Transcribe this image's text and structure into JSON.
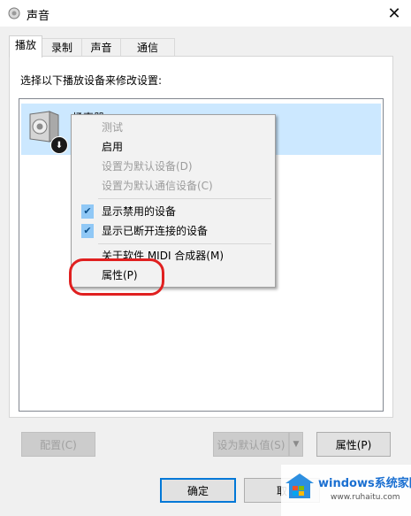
{
  "window": {
    "title": "声音",
    "close_glyph": "✕"
  },
  "tabs": [
    {
      "label": "播放",
      "active": true
    },
    {
      "label": "录制",
      "active": false
    },
    {
      "label": "声音",
      "active": false
    },
    {
      "label": "通信",
      "active": false
    }
  ],
  "panel": {
    "instruction": "选择以下播放设备来修改设置:",
    "device": {
      "name": "扬声器",
      "state": "disabled",
      "icon": "speaker-icon"
    }
  },
  "buttons": {
    "configure": "配置(C)",
    "set_default": "设为默认值(S)",
    "properties": "属性(P)",
    "ok": "确定",
    "cancel": "取"
  },
  "context_menu": {
    "items": [
      {
        "label": "测试",
        "enabled": false,
        "checked": false
      },
      {
        "label": "启用",
        "enabled": true,
        "checked": false
      },
      {
        "label": "设置为默认设备(D)",
        "enabled": false,
        "checked": false
      },
      {
        "label": "设置为默认通信设备(C)",
        "enabled": false,
        "checked": false
      },
      {
        "label": "显示禁用的设备",
        "enabled": true,
        "checked": true
      },
      {
        "label": "显示已断开连接的设备",
        "enabled": true,
        "checked": true
      },
      {
        "label": "关于软件 MIDI 合成器(M)",
        "enabled": true,
        "checked": false
      },
      {
        "label": "属性(P)",
        "enabled": true,
        "checked": false
      }
    ]
  },
  "annotation": {
    "highlight_color": "#e02020",
    "target": "属性(P)"
  },
  "watermark": {
    "title": "windows系统家园",
    "url": "www.ruhaitu.com"
  },
  "colors": {
    "selection": "#cce8ff",
    "accent": "#0078d7"
  }
}
